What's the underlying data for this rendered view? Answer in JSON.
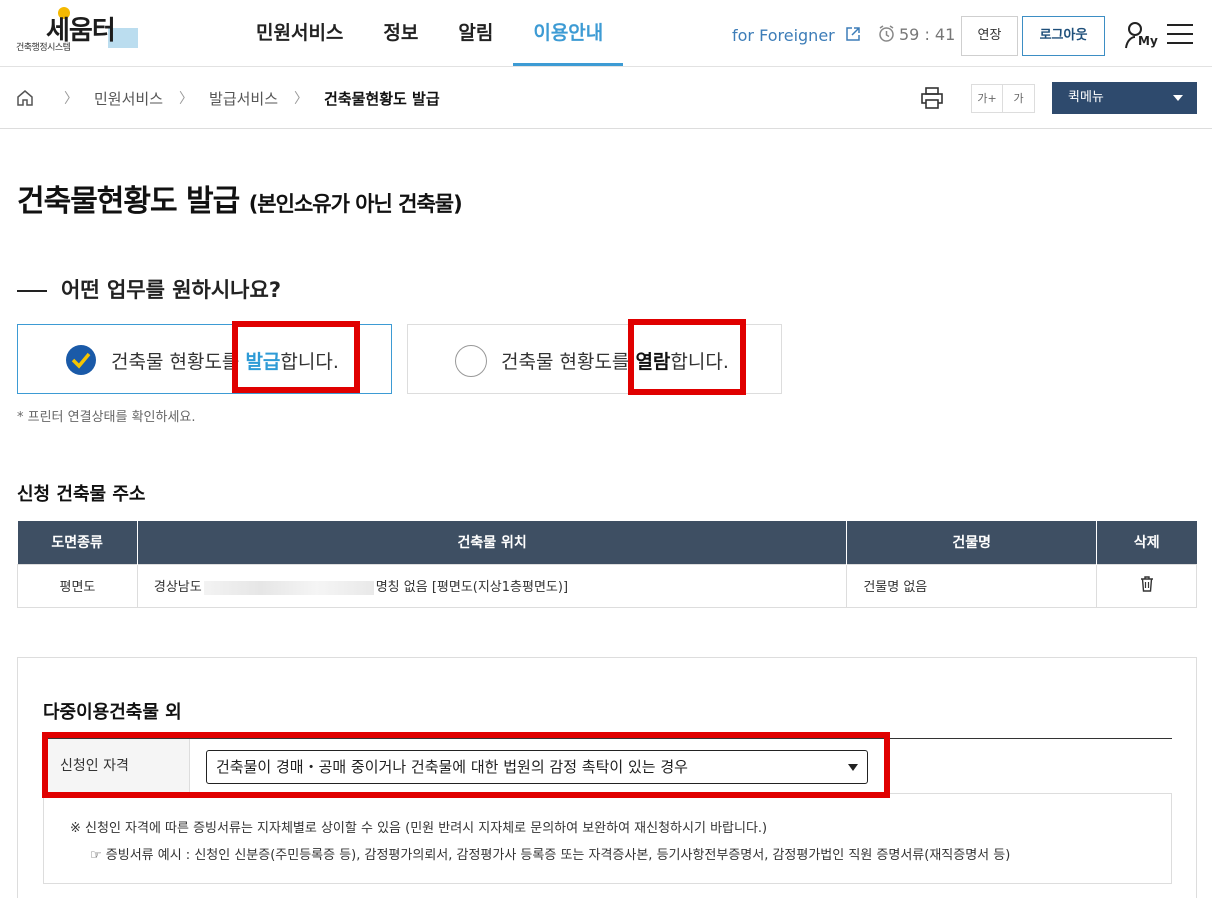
{
  "header": {
    "logo_text": "세움터",
    "logo_sub": "건축행정시스템",
    "nav": [
      "민원서비스",
      "정보",
      "알림",
      "이용안내"
    ],
    "nav_active": "이용안내",
    "foreigner_link": "for Foreigner",
    "timer": "59 : 41",
    "extend_label": "연장",
    "logout_label": "로그아웃",
    "my_label": "My"
  },
  "breadcrumb": {
    "items": [
      "민원서비스",
      "발급서비스",
      "건축물현황도 발급"
    ],
    "font_up": "가+",
    "font_down": "가",
    "quickmenu": "퀵메뉴"
  },
  "page": {
    "title": "건축물현황도 발급",
    "title_sub": "(본인소유가 아닌 건축물)",
    "question": "어떤 업무를 원하시나요?",
    "option1": {
      "pre": "건축물 현황도를 ",
      "key": "발급",
      "post": "합니다.",
      "selected": true
    },
    "option2": {
      "pre": "건축물 현황도를 ",
      "key": "열람",
      "post": "합니다.",
      "selected": false
    },
    "print_note": "* 프린터 연결상태를 확인하세요."
  },
  "address": {
    "section_title": "신청 건축물 주소",
    "columns": [
      "도면종류",
      "건축물 위치",
      "건물명",
      "삭제"
    ],
    "rows": [
      {
        "type": "평면도",
        "loc_pre": "경상남도",
        "loc_post": "명칭 없음 [평면도(지상1층평면도)]",
        "name": "건물명 없음"
      }
    ]
  },
  "multi": {
    "title": "다중이용건축물 외",
    "qual_label": "신청인 자격",
    "qual_value": "건축물이 경매・공매 중이거나 건축물에 대한 법원의 감정 촉탁이 있는 경우",
    "note1": "※ 신청인 자격에 따른 증빙서류는 지자체별로 상이할 수 있음 (민원 반려시 지자체로 문의하여 보완하여 재신청하시기 바랍니다.)",
    "note2": "☞ 증빙서류 예시 : 신청인 신분증(주민등록증 등), 감정평가의뢰서, 감정평가사 등록증 또는 자격증사본, 등기사항전부증명서, 감정평가법인 직원 증명서류(재직증명서 등)"
  },
  "colors": {
    "accent": "#3d9bd4",
    "navy": "#2e4a6d",
    "table_head": "#3e4f63",
    "highlight_box": "#e00000"
  }
}
